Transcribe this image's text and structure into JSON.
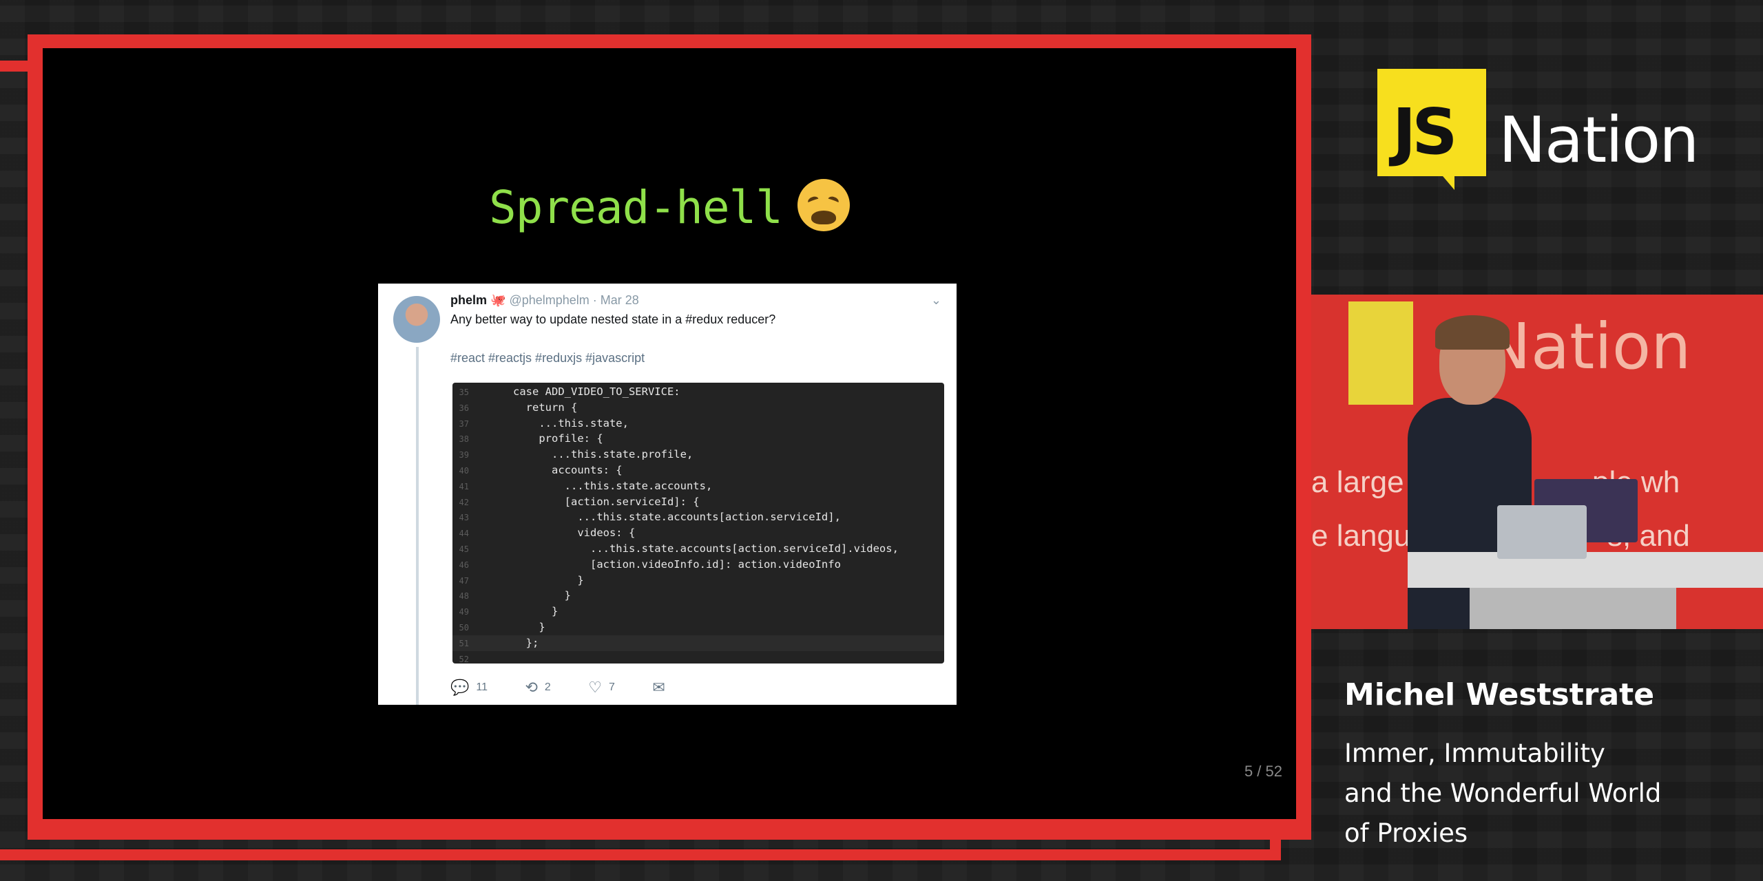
{
  "slide": {
    "title": "Spread-hell",
    "emoji": "weary-face",
    "page_indicator": "5 / 52"
  },
  "tweet": {
    "display_name": "phelm",
    "handle_date": "@phelmphelm · Mar 28",
    "text": "Any better way to update nested state in a #redux reducer?",
    "tags": "#react #reactjs #reduxjs #javascript",
    "replies": "11",
    "retweets": "2",
    "likes": "7",
    "code_lines": [
      {
        "n": "35",
        "code": "case ADD_VIDEO_TO_SERVICE:"
      },
      {
        "n": "36",
        "code": "  return {"
      },
      {
        "n": "37",
        "code": "    ...this.state,"
      },
      {
        "n": "38",
        "code": "    profile: {"
      },
      {
        "n": "39",
        "code": "      ...this.state.profile,"
      },
      {
        "n": "40",
        "code": "      accounts: {"
      },
      {
        "n": "41",
        "code": "        ...this.state.accounts,"
      },
      {
        "n": "42",
        "code": "        [action.serviceId]: {"
      },
      {
        "n": "43",
        "code": "          ...this.state.accounts[action.serviceId],"
      },
      {
        "n": "44",
        "code": "          videos: {"
      },
      {
        "n": "45",
        "code": "            ...this.state.accounts[action.serviceId].videos,"
      },
      {
        "n": "46",
        "code": "            [action.videoInfo.id]: action.videoInfo"
      },
      {
        "n": "47",
        "code": "          }"
      },
      {
        "n": "48",
        "code": "        }"
      },
      {
        "n": "49",
        "code": "      }"
      },
      {
        "n": "50",
        "code": "    }"
      },
      {
        "n": "51",
        "code": "  };"
      },
      {
        "n": "52",
        "code": ""
      }
    ]
  },
  "brand": {
    "logo_js": "JS",
    "logo_nation": "Nation",
    "yellow": "#f7df1e",
    "red": "#e2302e"
  },
  "camera": {
    "backdrop_logo": "Nation",
    "backdrop_line1": "a large",
    "backdrop_line2": "e langua",
    "backdrop_line3": "ple wh",
    "backdrop_line4": "s, and"
  },
  "speaker": {
    "name": "Michel Weststrate",
    "talk_title_line1": "Immer, Immutability",
    "talk_title_line2": "and the Wonderful World",
    "talk_title_line3": "of Proxies"
  }
}
